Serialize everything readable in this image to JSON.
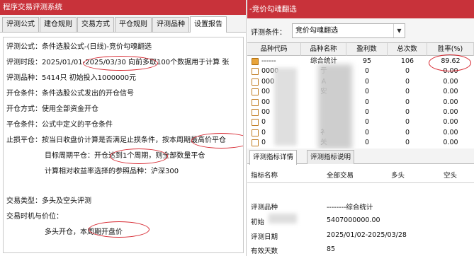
{
  "left_window": {
    "title": "程序交易评测系统",
    "tabs": [
      "评测公式",
      "建仓规则",
      "交易方式",
      "平仓规则",
      "评测品种",
      "设置报告"
    ],
    "active_tab": 5,
    "report": [
      {
        "label": "评测公式：",
        "value": "条件选股公式-(日线)-竞价勾魂翻选"
      },
      {
        "label": "评测时段：",
        "value": "2025/01/01-2025/03/30 向前多取100个数据用于计算 张"
      },
      {
        "label": "评测品种：",
        "value": "5414只 初始投入1000000元"
      },
      {
        "label": "开仓条件：",
        "value": "条件选股公式发出的开仓信号"
      },
      {
        "label": "开仓方式：",
        "value": "使用全部资金开仓"
      },
      {
        "label": "平仓条件：",
        "value": "公式中定义的平仓条件"
      },
      {
        "label": "止损平仓：",
        "value": "按当日收盘价计算是否满足止损条件，按本周期最高价平仓"
      },
      {
        "label": "",
        "value": "目标周期平仓：开仓达到1个周期，则全部数量平仓"
      },
      {
        "label": "",
        "value": "计算相对收益率选择的参照品种：沪深300"
      },
      {
        "label": "交易类型：",
        "value": "多头及空头评测"
      },
      {
        "label": "交易时机与价位：",
        "value": ""
      },
      {
        "label": "",
        "value": "多头开仓，本周期开盘价"
      }
    ]
  },
  "right_window": {
    "title": "-竞价勾魂翻选",
    "condition_label": "评测条件：",
    "condition_value": "竞价勾魂翻选",
    "columns": [
      "品种代码",
      "品种名称",
      "盈利数",
      "总次数",
      "胜率(%)"
    ],
    "rows": [
      {
        "code": "------",
        "name": "综合统计",
        "win": "95",
        "total": "106",
        "rate": "89.62",
        "summary": true
      },
      {
        "code": "0000",
        "name": "亍",
        "win": "0",
        "total": "0",
        "rate": "0.00"
      },
      {
        "code": "000",
        "name": "A",
        "win": "0",
        "total": "0",
        "rate": "0.00"
      },
      {
        "code": "00",
        "name": "安",
        "win": "0",
        "total": "0",
        "rate": "0.00"
      },
      {
        "code": "00",
        "name": "",
        "win": "0",
        "total": "0",
        "rate": "0.00"
      },
      {
        "code": "00",
        "name": "",
        "win": "0",
        "total": "0",
        "rate": "0.00"
      },
      {
        "code": "0",
        "name": "",
        "win": "0",
        "total": "0",
        "rate": "0.00"
      },
      {
        "code": "0",
        "name": "衤",
        "win": "0",
        "total": "0",
        "rate": "0.00"
      },
      {
        "code": "0",
        "name": "关",
        "win": "0",
        "total": "0",
        "rate": "0.00"
      }
    ],
    "detail_tabs": [
      "评测指标详情",
      "评测指标说明"
    ],
    "detail_columns": [
      "指标名称",
      "全部交易",
      "多头",
      "空头"
    ],
    "detail_rows": [
      {
        "name": "评测品种",
        "value": "--------综合统计"
      },
      {
        "name": "初始",
        "value": "5407000000.00"
      },
      {
        "name": "评测日期",
        "value": "2025/01/02-2025/03/28"
      },
      {
        "name": "有效天数",
        "value": "85"
      }
    ],
    "dropdown_arrow_icon": "chevron-down-icon"
  },
  "colors": {
    "title_bar": "#c8323a",
    "highlight_circle": "#d6242d"
  }
}
